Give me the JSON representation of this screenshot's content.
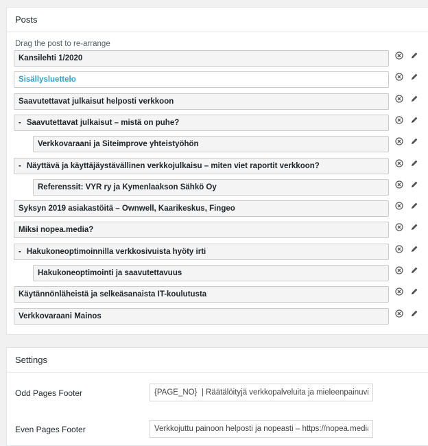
{
  "posts": {
    "title": "Posts",
    "hint": "Drag the post to re-arrange",
    "items": [
      {
        "label": "Kansilehti 1/2020",
        "level": 0,
        "dash": false,
        "active": false
      },
      {
        "label": "Sisällysluettelo",
        "level": 0,
        "dash": false,
        "active": true
      },
      {
        "label": "Saavutettavat julkaisut helposti verkkoon",
        "level": 0,
        "dash": false,
        "active": false
      },
      {
        "label": "Saavutettavat julkaisut – mistä on puhe?",
        "level": 0,
        "dash": true,
        "active": false
      },
      {
        "label": "Verkkovaraani ja Siteimprove yhteistyöhön",
        "level": 1,
        "dash": false,
        "active": false
      },
      {
        "label": "Näyttävä ja käyttäjäystävällinen verkkojulkaisu – miten viet raportit verkkoon?",
        "level": 0,
        "dash": true,
        "active": false
      },
      {
        "label": "Referenssit: VYR ry ja Kymenlaakson Sähkö Oy",
        "level": 1,
        "dash": false,
        "active": false
      },
      {
        "label": "Syksyn 2019 asiakastöitä – Ownwell, Kaarikeskus, Fingeo",
        "level": 0,
        "dash": false,
        "active": false
      },
      {
        "label": "Miksi nopea.media?",
        "level": 0,
        "dash": false,
        "active": false
      },
      {
        "label": "Hakukoneoptimoinnilla verkkosivuista hyöty irti",
        "level": 0,
        "dash": true,
        "active": false
      },
      {
        "label": "Hakukoneoptimointi ja saavutettavuus",
        "level": 1,
        "dash": false,
        "active": false
      },
      {
        "label": "Käytännönläheistä ja selkeäsanaista IT-koulutusta",
        "level": 0,
        "dash": false,
        "active": false
      },
      {
        "label": "Verkkovaraani Mainos",
        "level": 0,
        "dash": false,
        "active": false
      }
    ],
    "dash_symbol": "-",
    "remove_icon": "circle-x-icon",
    "edit_icon": "pencil-icon"
  },
  "settings": {
    "title": "Settings",
    "odd_label": "Odd Pages Footer",
    "odd_value": "{PAGE_NO}  | Räätälöityjä verkkopalveluita ja mieleenpainuvia",
    "even_label": "Even Pages Footer",
    "even_value": "Verkkojuttu painoon helposti ja nopeasti – https://nopea.media"
  },
  "colors": {
    "active_text": "#2ea2cc",
    "row_bg": "#f4f4f4",
    "row_border": "#c9c9c9"
  }
}
